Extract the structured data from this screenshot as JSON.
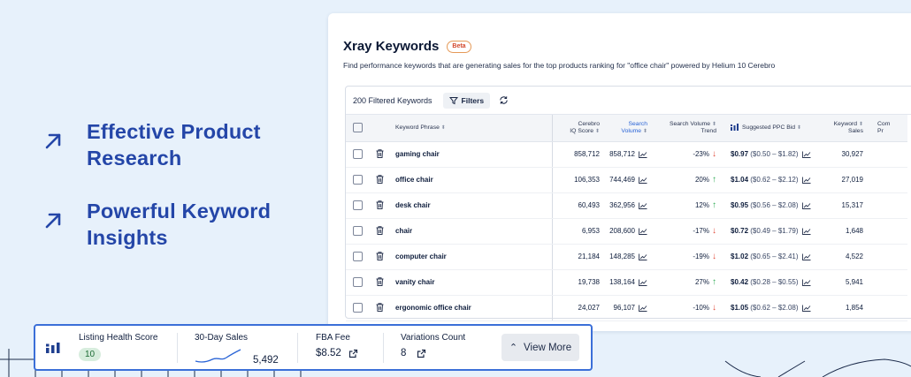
{
  "features": [
    {
      "line1": "Effective Product",
      "line2": "Research"
    },
    {
      "line1": "Powerful Keyword",
      "line2": "Insights"
    }
  ],
  "card": {
    "title": "Xray Keywords",
    "badge": "Beta",
    "subtitle": "Find performance keywords that are generating sales for the top products ranking for \"office chair\" powered by Helium 10 Cerebro"
  },
  "toolbar": {
    "count_label": "200 Filtered Keywords",
    "filters_label": "Filters"
  },
  "table": {
    "headers": {
      "keyword": "Keyword Phrase",
      "iq1": "Cerebro",
      "iq2": "IQ Score",
      "sv1": "Search",
      "sv2": "Volume",
      "tr1": "Search Volume",
      "tr2": "Trend",
      "bid": "Suggested PPC Bid",
      "ks1": "Keyword",
      "ks2": "Sales",
      "cp1": "Com",
      "cp2": "Pr"
    },
    "rows": [
      {
        "keyword": "gaming chair",
        "iq": "858,712",
        "sv": "858,712",
        "trend": "-23%",
        "dir": "down",
        "bid": "$0.97",
        "range": "($0.50 – $1.82)",
        "sales": "30,927"
      },
      {
        "keyword": "office chair",
        "iq": "106,353",
        "sv": "744,469",
        "trend": "20%",
        "dir": "up",
        "bid": "$1.04",
        "range": "($0.62 – $2.12)",
        "sales": "27,019"
      },
      {
        "keyword": "desk chair",
        "iq": "60,493",
        "sv": "362,956",
        "trend": "12%",
        "dir": "up",
        "bid": "$0.95",
        "range": "($0.56 – $2.08)",
        "sales": "15,317"
      },
      {
        "keyword": "chair",
        "iq": "6,953",
        "sv": "208,600",
        "trend": "-17%",
        "dir": "down",
        "bid": "$0.72",
        "range": "($0.49 – $1.79)",
        "sales": "1,648"
      },
      {
        "keyword": "computer chair",
        "iq": "21,184",
        "sv": "148,285",
        "trend": "-19%",
        "dir": "down",
        "bid": "$1.02",
        "range": "($0.65 – $2.41)",
        "sales": "4,522"
      },
      {
        "keyword": "vanity chair",
        "iq": "19,738",
        "sv": "138,164",
        "trend": "27%",
        "dir": "up",
        "bid": "$0.42",
        "range": "($0.28 – $0.55)",
        "sales": "5,941"
      },
      {
        "keyword": "ergonomic office chair",
        "iq": "24,027",
        "sv": "96,107",
        "trend": "-10%",
        "dir": "down",
        "bid": "$1.05",
        "range": "($0.62 – $2.08)",
        "sales": "1,854"
      }
    ]
  },
  "bar": {
    "health_label": "Listing Health Score",
    "health_value": "10",
    "sales_label": "30-Day Sales",
    "sales_value": "5,492",
    "fba_label": "FBA Fee",
    "fba_value": "$8.52",
    "var_label": "Variations Count",
    "var_value": "8",
    "view_more": "View More"
  },
  "colors": {
    "accent": "#2446a8",
    "link": "#2a64d6",
    "up": "#2faa55",
    "down": "#e04a3a",
    "bar_border": "#3b6fd8"
  }
}
